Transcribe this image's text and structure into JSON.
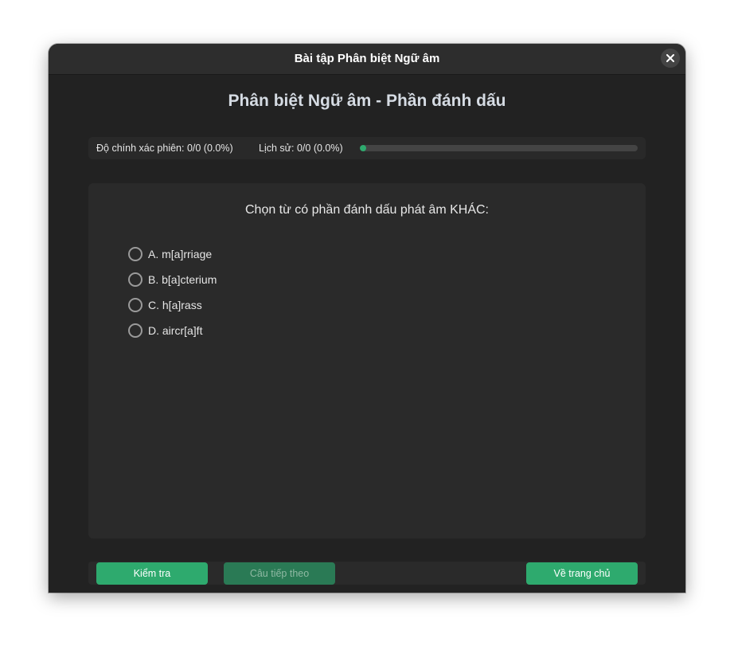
{
  "window": {
    "title": "Bài tập Phân biệt Ngữ âm",
    "close_icon": "close-icon"
  },
  "main": {
    "heading": "Phân biệt Ngữ âm - Phần đánh dấu"
  },
  "stats": {
    "session": "Độ chính xác phiên: 0/0 (0.0%)",
    "history": "Lịch sử: 0/0 (0.0%)",
    "progress_percent": 0
  },
  "question": {
    "prompt": "Chọn từ có phần đánh dấu phát âm KHÁC:",
    "options": [
      {
        "label": "A. m[a]rriage",
        "selected": false
      },
      {
        "label": "B. b[a]cterium",
        "selected": false
      },
      {
        "label": "C. h[a]rass",
        "selected": false
      },
      {
        "label": "D. aircr[a]ft",
        "selected": false
      }
    ]
  },
  "buttons": {
    "check": "Kiểm tra",
    "next": "Câu tiếp theo",
    "home": "Về trang chủ"
  },
  "colors": {
    "accent": "#2eaa6e",
    "accent_disabled": "#2a7a55",
    "background": "#222222",
    "panel": "#2a2a2a"
  }
}
